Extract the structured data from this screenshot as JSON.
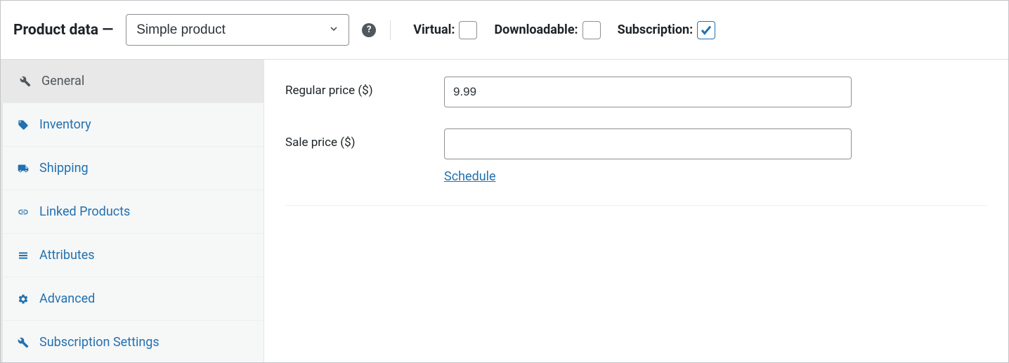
{
  "header": {
    "title": "Product data —",
    "product_type": "Simple product",
    "help_glyph": "?",
    "options": {
      "virtual": {
        "label": "Virtual:",
        "checked": false
      },
      "downloadable": {
        "label": "Downloadable:",
        "checked": false
      },
      "subscription": {
        "label": "Subscription:",
        "checked": true
      }
    }
  },
  "sidebar": {
    "items": [
      {
        "key": "general",
        "label": "General",
        "icon": "wrench-icon",
        "active": true
      },
      {
        "key": "inventory",
        "label": "Inventory",
        "icon": "tag-icon",
        "active": false
      },
      {
        "key": "shipping",
        "label": "Shipping",
        "icon": "truck-icon",
        "active": false
      },
      {
        "key": "linked",
        "label": "Linked Products",
        "icon": "link-icon",
        "active": false
      },
      {
        "key": "attributes",
        "label": "Attributes",
        "icon": "list-icon",
        "active": false
      },
      {
        "key": "advanced",
        "label": "Advanced",
        "icon": "gear-icon",
        "active": false
      },
      {
        "key": "subscription_settings",
        "label": "Subscription Settings",
        "icon": "wrench-icon",
        "active": false
      }
    ]
  },
  "form": {
    "regular_price": {
      "label": "Regular price ($)",
      "value": "9.99"
    },
    "sale_price": {
      "label": "Sale price ($)",
      "value": "",
      "schedule_label": "Schedule"
    }
  }
}
